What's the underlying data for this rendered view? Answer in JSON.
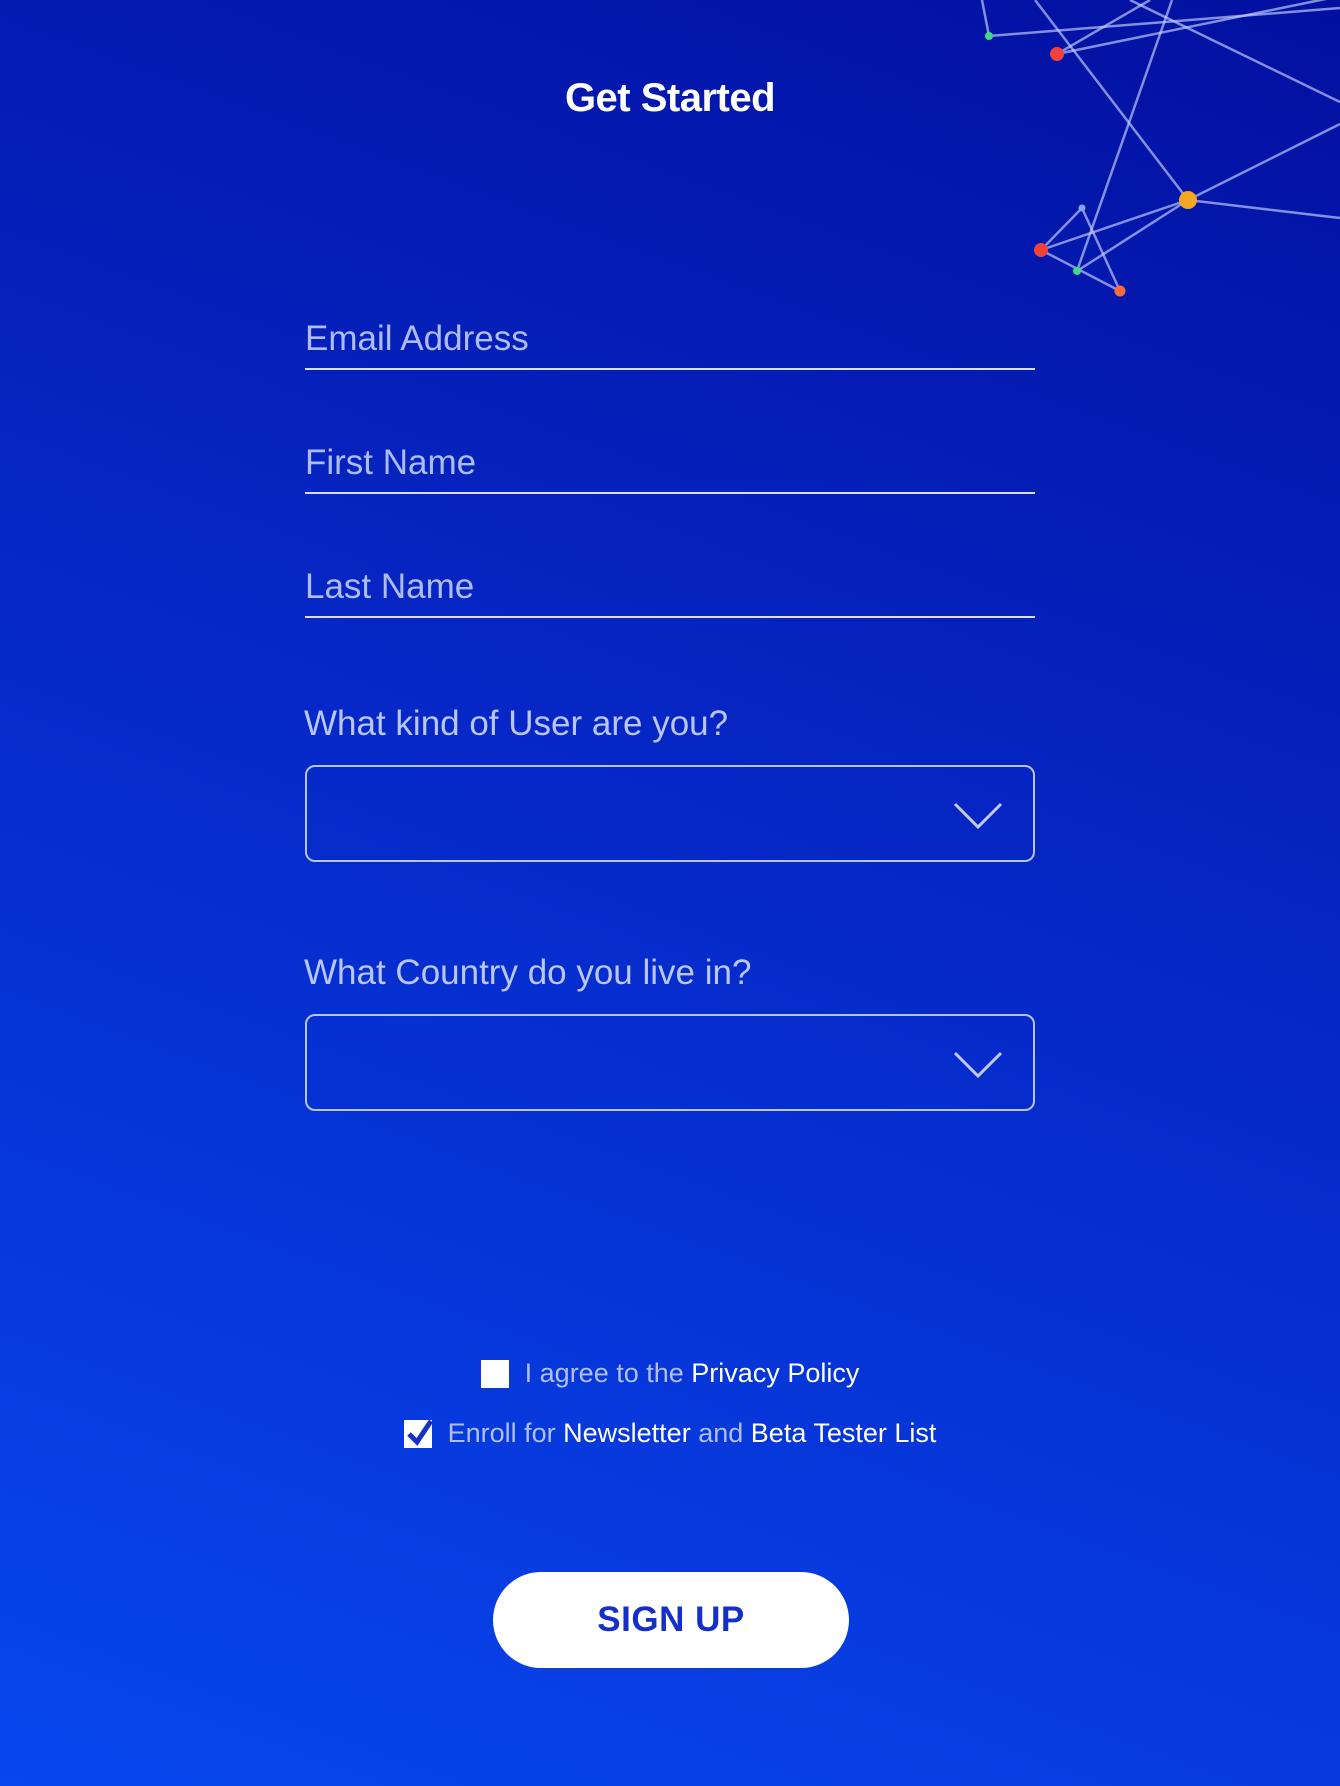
{
  "header": {
    "title": "Get Started"
  },
  "form": {
    "email": {
      "placeholder": "Email Address",
      "value": ""
    },
    "first_name": {
      "placeholder": "First Name",
      "value": ""
    },
    "last_name": {
      "placeholder": "Last Name",
      "value": ""
    },
    "user_type": {
      "label": "What kind of User are you?",
      "selected": ""
    },
    "country": {
      "label": "What Country do you live in?",
      "selected": ""
    }
  },
  "consents": {
    "privacy": {
      "prefix": "I agree to the",
      "link": "Privacy Policy",
      "checked": false
    },
    "newsletter": {
      "prefix": "Enroll for",
      "link1": "Newsletter",
      "middle": "and",
      "link2": "Beta Tester List",
      "checked": true
    }
  },
  "submit": {
    "label": "SIGN UP"
  },
  "colors": {
    "background_top": "#0210a0",
    "background_bottom": "#0747ee",
    "button_text": "#1530c8",
    "node_red": "#f0413c",
    "node_orange": "#f5a623",
    "node_green": "#3ddc84"
  },
  "icons": {
    "dropdown": "chevron-down-icon",
    "checkmark": "checkmark-icon",
    "decoration": "network-graph-decoration"
  }
}
